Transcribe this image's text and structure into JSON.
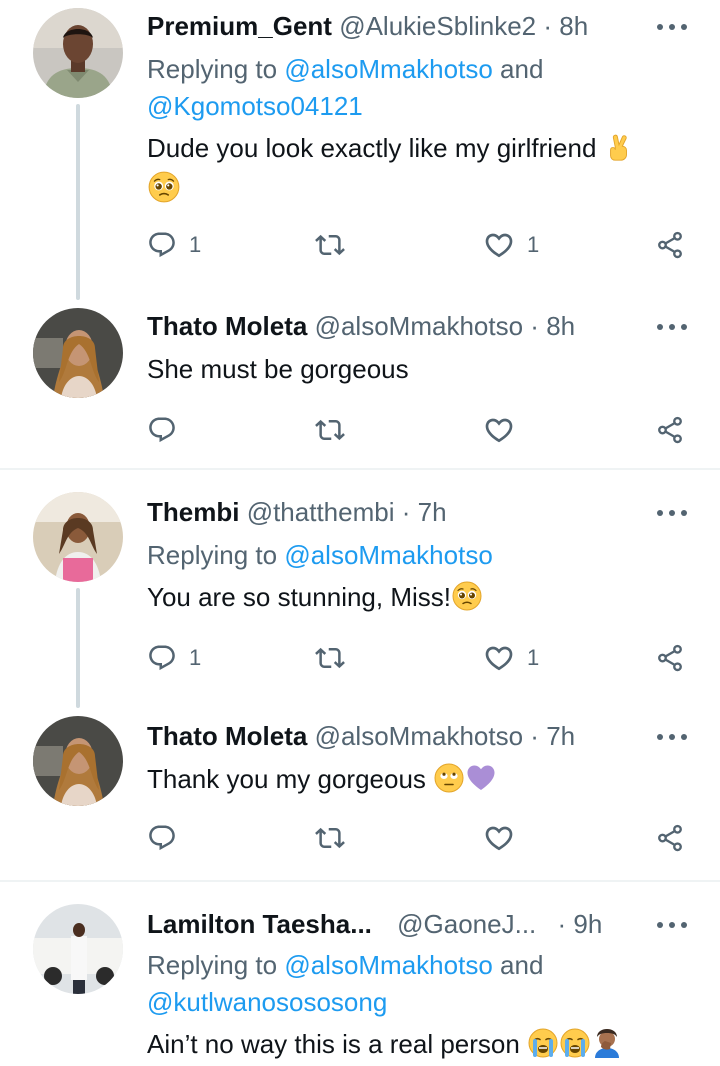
{
  "tweets": [
    {
      "name": "Premium_Gent",
      "handle": "@AlukieSblinke2",
      "time": "8h",
      "reply_prefix": "Replying to ",
      "reply_mentions_1": "@alsoMmakhotso",
      "reply_and": " and",
      "reply_mentions_2": "@Kgomotso04121",
      "text_line1": "Dude you look exactly like my girlfriend",
      "replies": "1",
      "likes": "1"
    },
    {
      "name": "Thato Moleta",
      "handle": "@alsoMmakhotso",
      "time": "8h",
      "text_line1": "She must be gorgeous"
    },
    {
      "name": "Thembi",
      "handle": "@thatthembi",
      "time": "7h",
      "reply_prefix": "Replying to ",
      "reply_mentions_1": "@alsoMmakhotso",
      "text_line1": "You are so stunning, Miss!",
      "replies": "1",
      "likes": "1"
    },
    {
      "name": "Thato Moleta",
      "handle": "@alsoMmakhotso",
      "time": "7h",
      "text_line1": "Thank you my gorgeous"
    },
    {
      "name": "Lamilton Taesha...",
      "handle": "@GaoneJ...",
      "time": "9h",
      "reply_prefix": "Replying to ",
      "reply_mentions_1": "@alsoMmakhotso",
      "reply_and": " and",
      "reply_mentions_2": "@kutlwanosososong",
      "text_line1": "Ain’t no way this is a real person"
    }
  ],
  "separator": "·",
  "colors": {
    "text": "#0f1419",
    "secondary": "#536471",
    "link": "#1d9bf0",
    "thread_line": "#cfd9de",
    "divider": "#eff3f4"
  },
  "icons": [
    "reply-icon",
    "retweet-icon",
    "like-icon",
    "share-icon",
    "more-icon"
  ]
}
